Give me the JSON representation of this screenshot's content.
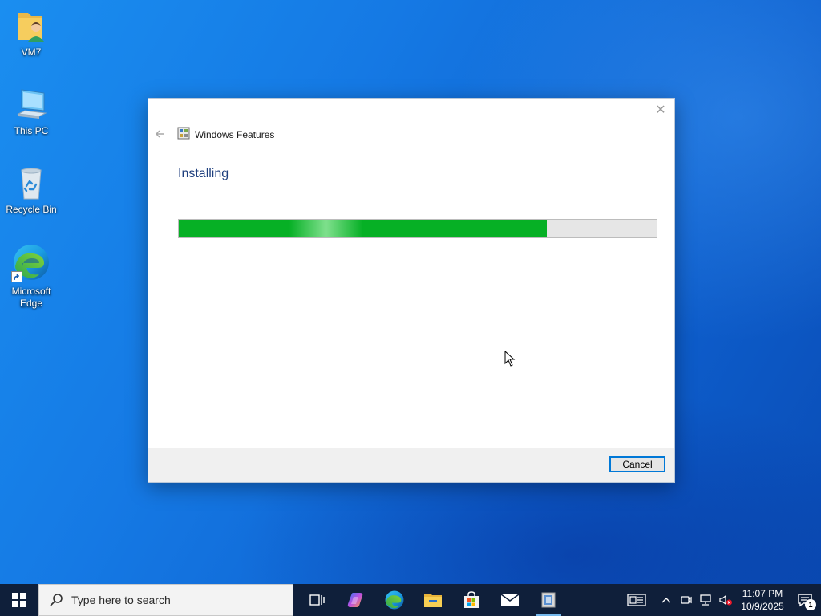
{
  "desktop": {
    "icons": [
      {
        "label": "VM7",
        "icon": "user-folder-icon"
      },
      {
        "label": "This PC",
        "icon": "computer-icon"
      },
      {
        "label": "Recycle Bin",
        "icon": "recycle-bin-icon"
      },
      {
        "label": "Microsoft\nEdge",
        "icon": "edge-icon"
      }
    ]
  },
  "dialog": {
    "title": "Windows Features",
    "heading": "Installing",
    "progress_percent": 77,
    "cancel_label": "Cancel",
    "close_glyph": "✕"
  },
  "taskbar": {
    "search_placeholder": "Type here to search",
    "apps": [
      "task-view-icon",
      "copilot-icon",
      "edge-icon",
      "file-explorer-icon",
      "store-icon",
      "mail-icon",
      "windows-features-icon"
    ],
    "clock": {
      "time": "11:07 PM",
      "date": "10/9/2025"
    },
    "notification_count": "1"
  },
  "colors": {
    "accent": "#0078d7",
    "progress_green": "#06b025",
    "heading_blue": "#1e3f7e",
    "taskbar": "#0f1f3a"
  }
}
